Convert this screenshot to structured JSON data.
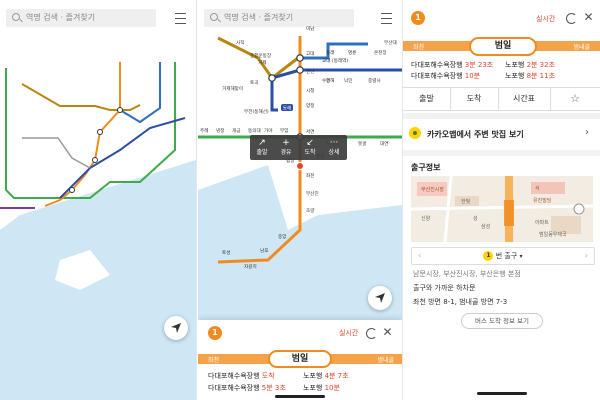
{
  "search": {
    "placeholder": "역명 검색 · 즐겨찾기"
  },
  "map_labels": {
    "p2": [
      "사직",
      "종합운동장",
      "미남",
      "고대",
      "동래",
      "교대 (동래역)",
      "명륜",
      "온천장",
      "부산대",
      "거제",
      "연산",
      "수안",
      "낙민",
      "충렬사",
      "거제해맞이",
      "토곡",
      "부전(동해선)",
      "시청",
      "동해",
      "양정",
      "주례",
      "냉정",
      "개금",
      "동의대",
      "가야",
      "부암",
      "부전",
      "서면",
      "지게골",
      "못골",
      "대연",
      "범일",
      "좌천",
      "부산진",
      "초량",
      "중앙",
      "남포",
      "자갈치",
      "토성",
      "범천"
    ],
    "line_badge": "동해"
  },
  "popup": {
    "buttons": [
      {
        "icon": "↗",
        "label": "출발"
      },
      {
        "icon": "+",
        "label": "경유"
      },
      {
        "icon": "↙",
        "label": "도착"
      },
      {
        "icon": "···",
        "label": "상세"
      }
    ]
  },
  "sheet_p2": {
    "line_number": "1",
    "realtime_label": "실시간",
    "station": "범일",
    "prev": "좌천",
    "next": "범내골",
    "rows": [
      {
        "left_station": "다대포해수욕장행",
        "left_time": "도착",
        "right_station": "노포행",
        "right_time": "4분 7초"
      },
      {
        "left_station": "다대포해수욕장행",
        "left_time": "5분 3초",
        "right_station": "노포행",
        "right_time": "10분"
      }
    ]
  },
  "detail": {
    "line_number": "1",
    "realtime_label": "실시간",
    "station": "범일",
    "prev": "좌천",
    "next": "범내골",
    "rows": [
      {
        "left_station": "다대포해수욕장행",
        "left_time": "3분 23초",
        "right_station": "노포행",
        "right_time": "2분 32초"
      },
      {
        "left_station": "다대포해수욕장행",
        "left_time": "10분",
        "right_station": "노포행",
        "right_time": "8분 11초"
      }
    ],
    "actions": [
      "출발",
      "도착",
      "시간표"
    ],
    "kakao_text": "카카오맵에서 주변 맛집 보기",
    "exit_section_title": "출구정보",
    "map_labels": [
      "부산진시장",
      "한빛",
      "신양",
      "성",
      "삼성",
      "석",
      "아파트",
      "유진빌딩",
      "범일동우체국"
    ],
    "exit_selector": "번 출구",
    "exit_number": "1",
    "info": [
      "남문시장, 부산진시장, 부산은행 본점",
      "출구와 가까운 하차문",
      "좌천 방면 8-1, 범내골 방면 7-3"
    ],
    "bus_button": "버스 도착 정보 보기"
  },
  "colors": {
    "line1": "#f28b1f",
    "line2": "#3daa4b",
    "line3": "#b8860b",
    "line4": "#2f6fbf",
    "donghae": "#2a4ea6",
    "sea": "#cfe7f5",
    "realtime": "#e2462c"
  }
}
